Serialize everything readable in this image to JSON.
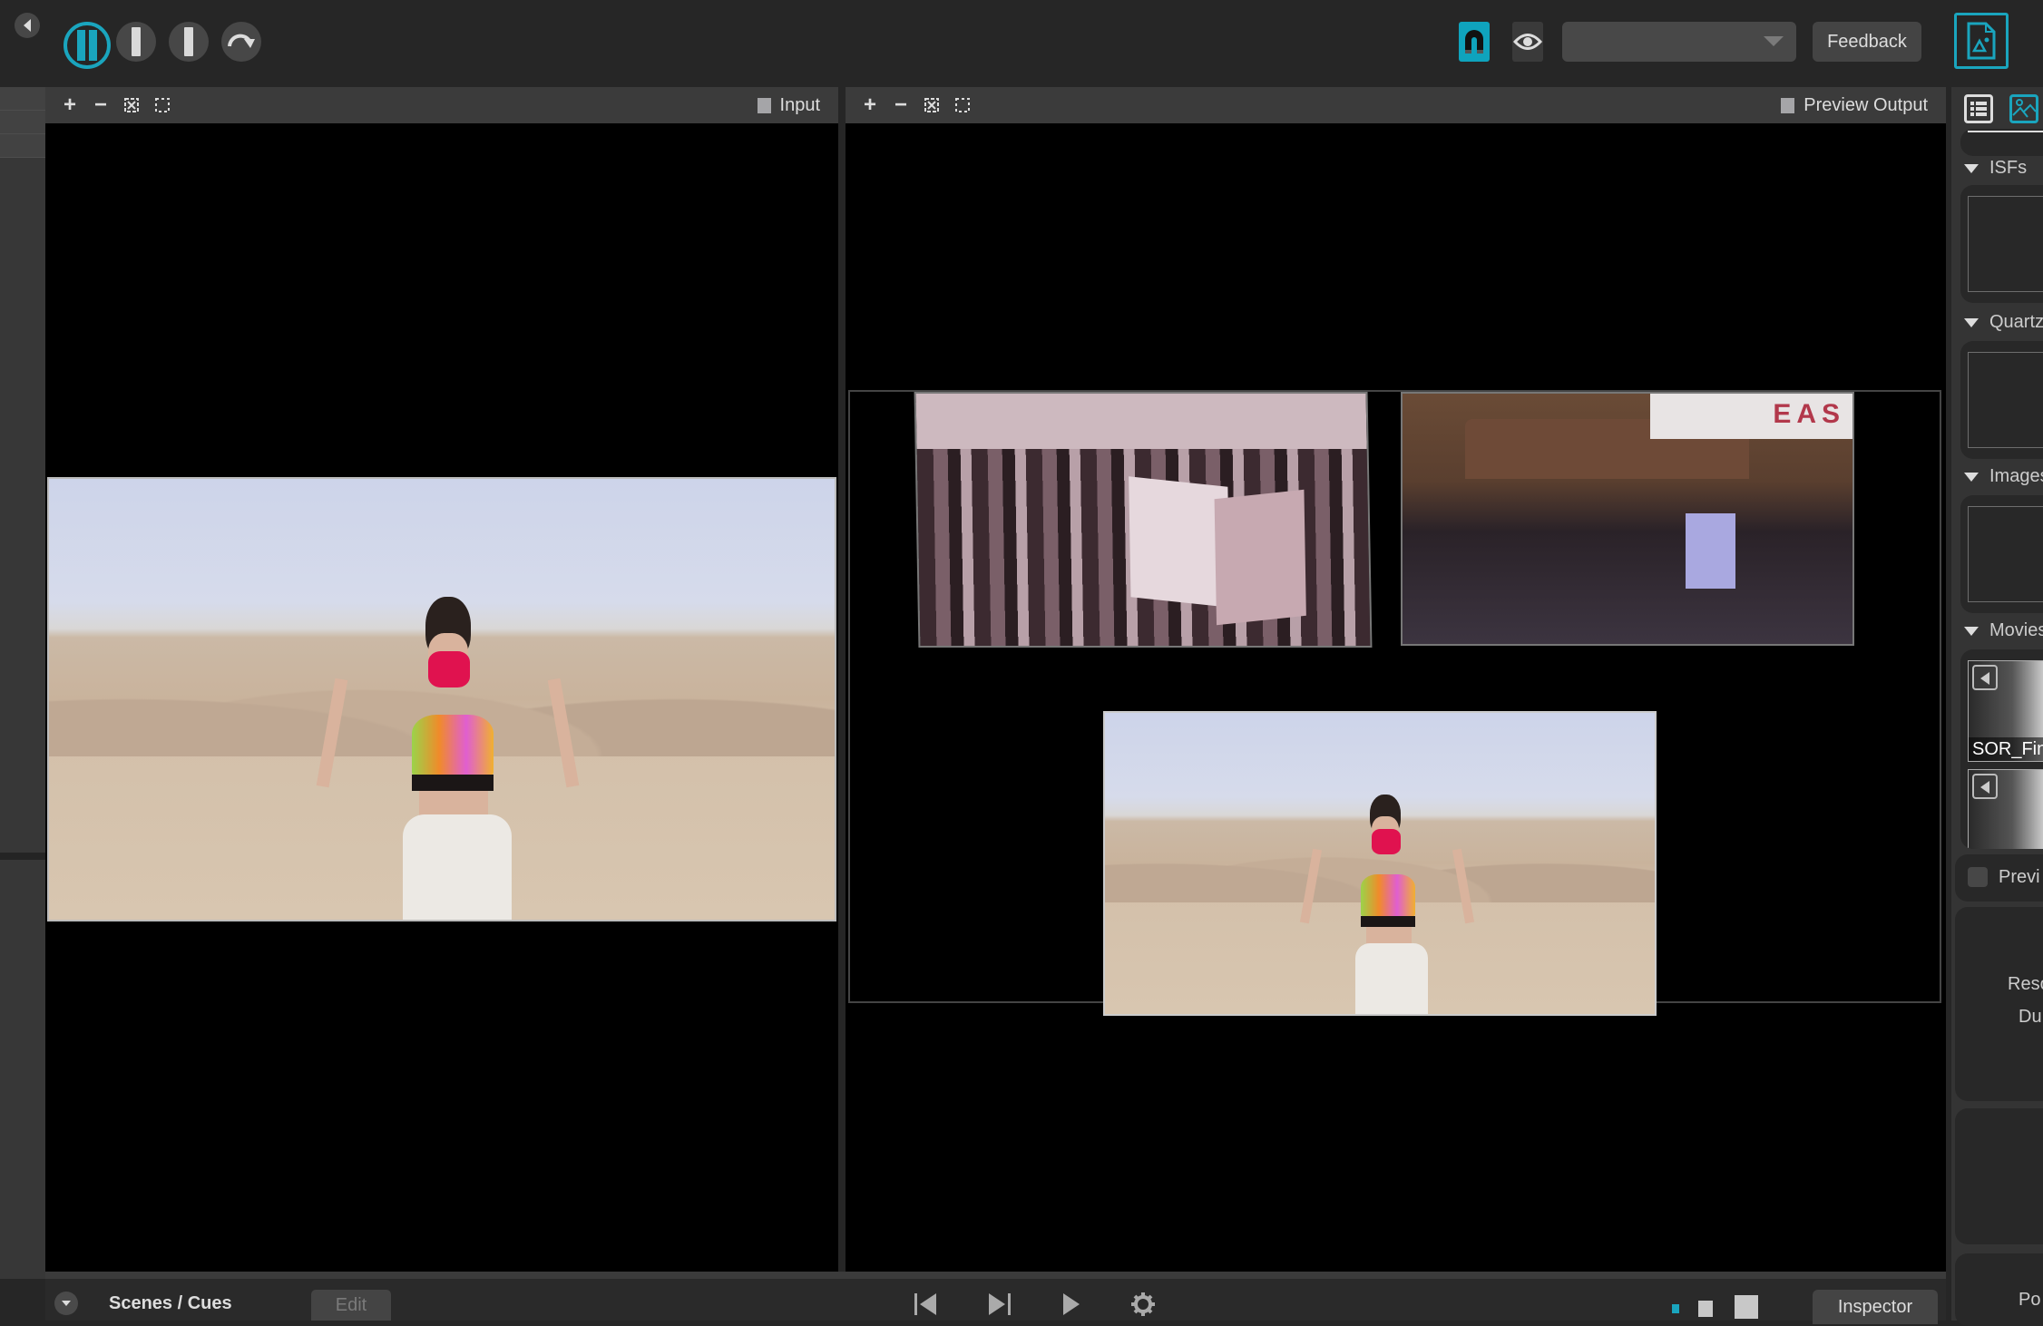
{
  "toolbar": {
    "back_icon": "chevron-left-icon",
    "pause_icon": "pause-icon",
    "step_icons": [
      "step-icon",
      "step-icon"
    ],
    "redo_icon": "redo-icon",
    "snap_icon": "magnet-icon",
    "visibility_icon": "eye-icon",
    "layout_select": {
      "value": ""
    },
    "feedback_label": "Feedback",
    "document_icon": "document-image-icon",
    "accent_color": "#1aa5be"
  },
  "input_panel": {
    "tools": [
      "+",
      "−",
      "fit",
      "select"
    ],
    "label": "Input"
  },
  "output_panel": {
    "tools": [
      "+",
      "−",
      "fit",
      "select"
    ],
    "label": "Preview Output",
    "slice_banner_text": "EAS"
  },
  "inspector": {
    "tabs": [
      "list-icon",
      "media-icon"
    ],
    "sections": [
      {
        "title": "ISFs"
      },
      {
        "title": "Quartz"
      },
      {
        "title": "Images"
      },
      {
        "title": "Movies"
      }
    ],
    "movies": [
      {
        "name": "SOR_Fina"
      },
      {
        "name": ""
      }
    ],
    "preview_label": "Previ",
    "info_labels": [
      "Reso",
      "Du",
      "("
    ],
    "footer_label": "Po"
  },
  "bottom_bar": {
    "scenes_label": "Scenes / Cues",
    "edit_label": "Edit",
    "transport": [
      "skip-back-icon",
      "skip-forward-icon",
      "play-icon",
      "gear-icon"
    ],
    "inspector_label": "Inspector"
  }
}
